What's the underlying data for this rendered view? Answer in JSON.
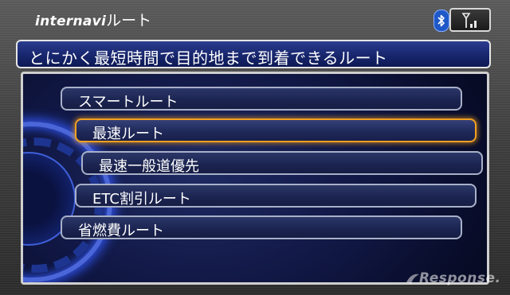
{
  "header": {
    "brand": "internavi",
    "title": "ルート"
  },
  "status": {
    "bluetooth_icon": "bluetooth-icon",
    "signal_icon": "signal-antenna-icon"
  },
  "banner": {
    "text": "とにかく最短時間で目的地まで到着できるルート"
  },
  "menu": {
    "items": [
      {
        "label": "スマートルート",
        "selected": false
      },
      {
        "label": "最速ルート",
        "selected": true
      },
      {
        "label": "最速一般道優先",
        "selected": false
      },
      {
        "label": "ETC割引ルート",
        "selected": false
      },
      {
        "label": "省燃費ルート",
        "selected": false
      }
    ]
  },
  "watermark": {
    "text": "Response."
  },
  "colors": {
    "accent_selected": "#f2a020",
    "banner_bg": "#16246a",
    "panel_bg": "#111845"
  }
}
